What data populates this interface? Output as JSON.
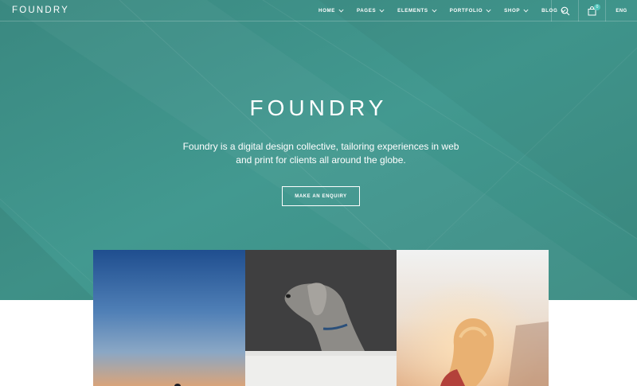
{
  "nav": {
    "logo": "FOUNDRY",
    "items": [
      {
        "label": "HOME",
        "name": "nav-item-home"
      },
      {
        "label": "PAGES",
        "name": "nav-item-pages"
      },
      {
        "label": "ELEMENTS",
        "name": "nav-item-elements"
      },
      {
        "label": "PORTFOLIO",
        "name": "nav-item-portfolio"
      },
      {
        "label": "SHOP",
        "name": "nav-item-shop"
      },
      {
        "label": "BLOG",
        "name": "nav-item-blog"
      }
    ],
    "cart_count": "0",
    "language": "ENG",
    "icons": {
      "search": "search-icon",
      "cart": "shopping-bag-icon",
      "dropdown": "chevron-down-icon"
    }
  },
  "hero": {
    "title": "FOUNDRY",
    "lead": "Foundry is a digital design collective, tailoring experiences in web and print for clients all around the globe.",
    "cta_label": "MAKE AN ENQUIRY"
  },
  "gallery": {
    "images": [
      "sky-dusk-photo",
      "dog-portrait-photo",
      "light-abstract-photo",
      "girl-sunset-photo"
    ]
  },
  "colors": {
    "hero_bg": "#3e8f86",
    "accent": "#4fc3b9",
    "text_light": "#ffffff"
  }
}
